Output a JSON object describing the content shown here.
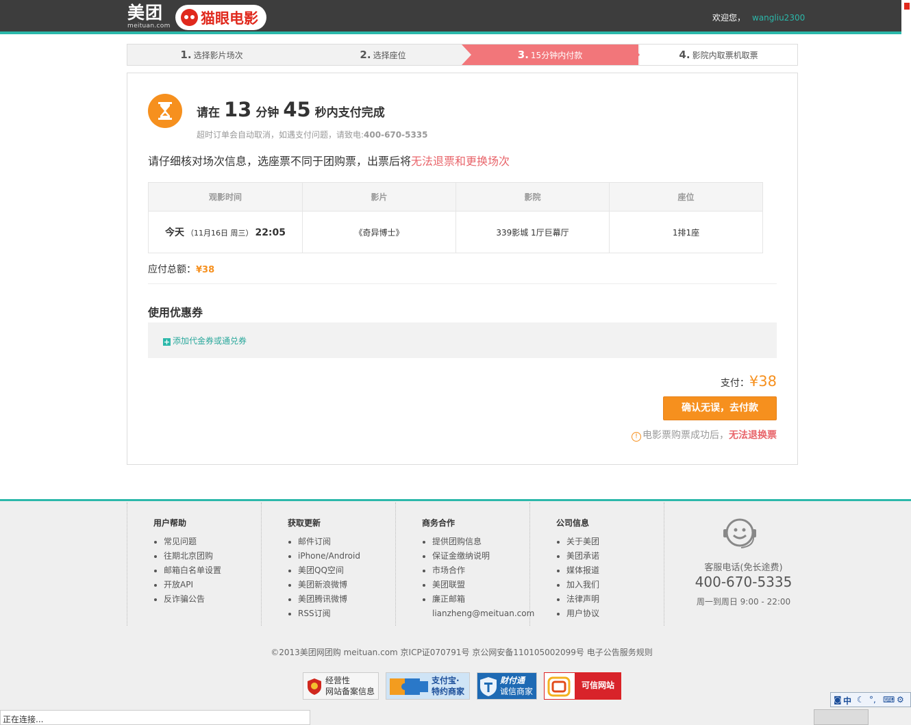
{
  "header": {
    "logo_cn": "美团",
    "logo_en": "meituan.com",
    "maoyan_logo": "猫眼电影",
    "welcome": "欢迎您，",
    "username": "wangliu2300"
  },
  "steps": [
    {
      "num": "1.",
      "label": "选择影片场次"
    },
    {
      "num": "2.",
      "label": "选择座位"
    },
    {
      "num": "3.",
      "label": "15分钟内付款"
    },
    {
      "num": "4.",
      "label": "影院内取票机取票"
    }
  ],
  "active_step": 3,
  "timer": {
    "prefix": "请在",
    "minutes": "13",
    "min_unit": "分钟",
    "seconds": "45",
    "suffix": "秒内支付完成",
    "sub": "超时订单会自动取消，如遇支付问题，请致电:",
    "phone": "400-670-5335"
  },
  "notice": {
    "text": "请仔细核对场次信息，选座票不同于团购票，出票后将",
    "warn": "无法退票和更换场次"
  },
  "order_table": {
    "headers": [
      "观影时间",
      "影片",
      "影院",
      "座位"
    ],
    "row": {
      "day": "今天",
      "date": "（11月16日 周三）",
      "time": "22:05",
      "movie": "《奇异博士》",
      "cinema": "339影城 1厅巨幕厅",
      "seat": "1排1座"
    }
  },
  "total": {
    "label": "应付总额：",
    "amount": "¥38"
  },
  "coupon": {
    "title": "使用优惠券",
    "add_label": "添加代金券或通兑券"
  },
  "pay": {
    "label": "支付：",
    "amount": "¥38",
    "button": "确认无误，去付款",
    "tip_prefix": "电影票购票成功后，",
    "tip_warn": "无法退换票"
  },
  "footer": {
    "columns": [
      {
        "title": "用户帮助",
        "items": [
          "常见问题",
          "往期北京团购",
          "邮箱白名单设置",
          "开放API",
          "反诈骗公告"
        ]
      },
      {
        "title": "获取更新",
        "items": [
          "邮件订阅",
          "iPhone/Android",
          "美团QQ空间",
          "美团新浪微博",
          "美团腾讯微博",
          "RSS订阅"
        ]
      },
      {
        "title": "商务合作",
        "items": [
          "提供团购信息",
          "保证金缴纳说明",
          "市场合作",
          "美团联盟",
          "廉正邮箱",
          "lianzheng@meituan.com"
        ]
      },
      {
        "title": "公司信息",
        "items": [
          "关于美团",
          "美团承诺",
          "媒体报道",
          "加入我们",
          "法律声明",
          "用户协议"
        ]
      }
    ],
    "service_label": "客服电话(免长途费)",
    "service_phone": "400-670-5335",
    "service_hours": "周一到周日 9:00 - 22:00",
    "copyright": "©2013美团网团购 meituan.com 京ICP证070791号 京公网安备110105002099号 电子公告服务规则",
    "badges": [
      {
        "line1": "经营性",
        "line2": "网站备案信息"
      },
      {
        "line1": "支付宝·",
        "line2": "特约商家"
      },
      {
        "line1": "财付通",
        "line2": "诚信商家"
      },
      {
        "line1": "可信网站",
        "line2": ""
      }
    ]
  },
  "status_bar": "正在连接...",
  "ime": "中",
  "colors": {
    "accent": "#2bb8aa",
    "orange": "#f6901e",
    "step_active": "#f2767a",
    "warn": "#e8646a"
  }
}
